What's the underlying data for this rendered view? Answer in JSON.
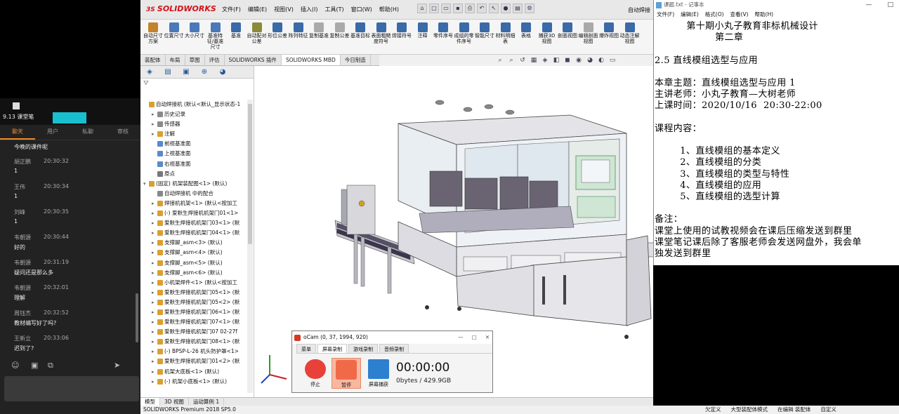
{
  "chat": {
    "window_title": "9.13 课堂笔",
    "tabs": [
      {
        "label": "聊天",
        "active": true
      },
      {
        "label": "用户",
        "active": false
      },
      {
        "label": "私聊",
        "active": false
      },
      {
        "label": "审核",
        "active": false
      }
    ],
    "first_message": "今晚的课件呢",
    "messages": [
      {
        "name": "胡正鹏",
        "time": "20:30:32",
        "text": "1"
      },
      {
        "name": "王伟",
        "time": "20:30:34",
        "text": "1"
      },
      {
        "name": "刘峰",
        "time": "20:30:35",
        "text": "1"
      },
      {
        "name": "韦朝源",
        "time": "20:30:44",
        "text": "好的"
      },
      {
        "name": "韦朝源",
        "time": "20:31:19",
        "text": "疑问还是那么多"
      },
      {
        "name": "韦朝源",
        "time": "20:32:01",
        "text": "理解"
      },
      {
        "name": "周钰杰",
        "time": "20:32:52",
        "text": "教材编写好了吗?"
      },
      {
        "name": "王新立",
        "time": "20:33:06",
        "text": "迟到了?"
      }
    ]
  },
  "solidworks": {
    "logo": "SOLIDWORKS",
    "menu": [
      "文件(F)",
      "编辑(E)",
      "视图(V)",
      "插入(I)",
      "工具(T)",
      "窗口(W)",
      "帮助(H)"
    ],
    "doc_title": "自动焊接",
    "ribbon": [
      {
        "label": "自动尺寸方案",
        "color": "#c2832b"
      },
      {
        "label": "位置尺寸",
        "color": "#4a78b8"
      },
      {
        "label": "大小尺寸",
        "color": "#4a78b8"
      },
      {
        "label": "基准特征/基准尺寸",
        "color": "#4a78b8"
      },
      {
        "label": "基准",
        "color": "#3a6aa8"
      },
      {
        "label": "自动配对公差",
        "color": "#8a8a3a"
      },
      {
        "label": "形位公差",
        "color": "#3a6aa8"
      },
      {
        "label": "阵列特征",
        "color": "#3a6aa8"
      },
      {
        "label": "复制基准",
        "color": "#aaaaaa"
      },
      {
        "label": "复制公差",
        "color": "#aaaaaa"
      },
      {
        "label": "基准目标",
        "color": "#3a6aa8"
      },
      {
        "label": "表面粗糙度符号",
        "color": "#3a6aa8"
      },
      {
        "label": "焊接符号",
        "color": "#3a6aa8"
      },
      {
        "label": "注释",
        "color": "#3a6aa8"
      },
      {
        "label": "零件序号",
        "color": "#3a6aa8"
      },
      {
        "label": "成组的零件序号",
        "color": "#3a6aa8"
      },
      {
        "label": "智能尺寸",
        "color": "#3a6aa8"
      },
      {
        "label": "材料明细表",
        "color": "#3a6aa8"
      },
      {
        "label": "表格",
        "color": "#3a6aa8"
      },
      {
        "label": "捕获3D视图",
        "color": "#3a6aa8"
      },
      {
        "label": "剖面视图",
        "color": "#3a6aa8"
      },
      {
        "label": "编辑剖面视图",
        "color": "#aaaaaa"
      },
      {
        "label": "爆炸视图",
        "color": "#3a6aa8"
      },
      {
        "label": "动态注解视图",
        "color": "#3a6aa8"
      }
    ],
    "command_tabs": [
      {
        "label": "装配体",
        "active": false
      },
      {
        "label": "布局",
        "active": false
      },
      {
        "label": "草图",
        "active": false
      },
      {
        "label": "评估",
        "active": false
      },
      {
        "label": "SOLIDWORKS 插件",
        "active": false
      },
      {
        "label": "SOLIDWORKS MBD",
        "active": true
      },
      {
        "label": "今日制造",
        "active": false
      }
    ],
    "tree": [
      {
        "label": "自动焊接机 (默认<默认_显示状态-1",
        "indent": 0,
        "expander": "",
        "icon": "#d9a030"
      },
      {
        "label": "历史记录",
        "indent": 1,
        "expander": "▸",
        "icon": "#8a8a8a"
      },
      {
        "label": "传感器",
        "indent": 1,
        "expander": "▸",
        "icon": "#8a8a8a"
      },
      {
        "label": "注解",
        "indent": 1,
        "expander": "▸",
        "icon": "#d9a030"
      },
      {
        "label": "前视基准面",
        "indent": 1,
        "expander": "",
        "icon": "#5a8ac8"
      },
      {
        "label": "上视基准面",
        "indent": 1,
        "expander": "",
        "icon": "#5a8ac8"
      },
      {
        "label": "右视基准面",
        "indent": 1,
        "expander": "",
        "icon": "#5a8ac8"
      },
      {
        "label": "原点",
        "indent": 1,
        "expander": "",
        "icon": "#777777"
      },
      {
        "label": "(固定) 机架装配图<1> (默认)",
        "indent": 0,
        "expander": "▾",
        "icon": "#d9a030"
      },
      {
        "label": "自动焊接机 中的配合",
        "indent": 1,
        "expander": "",
        "icon": "#888888"
      },
      {
        "label": "焊接机机架<1> (默认<按加工",
        "indent": 1,
        "expander": "▸",
        "icon": "#d9a030"
      },
      {
        "label": "(-) 爱默生焊接机机架门01<1>",
        "indent": 1,
        "expander": "▸",
        "icon": "#d9a030"
      },
      {
        "label": "爱默生焊接机机架门03<1> (默",
        "indent": 1,
        "expander": "▸",
        "icon": "#d9a030"
      },
      {
        "label": "爱默生焊接机机架门04<1> (默",
        "indent": 1,
        "expander": "▸",
        "icon": "#d9a030"
      },
      {
        "label": "支撑脚_asm<3> (默认)",
        "indent": 1,
        "expander": "▸",
        "icon": "#d9a030"
      },
      {
        "label": "支撑脚_asm<4> (默认)",
        "indent": 1,
        "expander": "▸",
        "icon": "#d9a030"
      },
      {
        "label": "支撑脚_asm<5> (默认)",
        "indent": 1,
        "expander": "▸",
        "icon": "#d9a030"
      },
      {
        "label": "支撑脚_asm<6> (默认)",
        "indent": 1,
        "expander": "▸",
        "icon": "#d9a030"
      },
      {
        "label": "小机架焊件<1> (默认<按加工",
        "indent": 1,
        "expander": "▸",
        "icon": "#d9a030"
      },
      {
        "label": "爱默生焊接机机架门05<1> (默",
        "indent": 1,
        "expander": "▸",
        "icon": "#d9a030"
      },
      {
        "label": "爱默生焊接机机架门05<2> (默",
        "indent": 1,
        "expander": "▸",
        "icon": "#d9a030"
      },
      {
        "label": "爱默生焊接机机架门06<1> (默",
        "indent": 1,
        "expander": "▸",
        "icon": "#d9a030"
      },
      {
        "label": "爱默生焊接机机架门07<1> (默",
        "indent": 1,
        "expander": "▸",
        "icon": "#d9a030"
      },
      {
        "label": "爱默生焊接机机架门07 02-27f",
        "indent": 1,
        "expander": "▸",
        "icon": "#d9a030"
      },
      {
        "label": "爱默生焊接机机架门08<1> (默",
        "indent": 1,
        "expander": "▸",
        "icon": "#d9a030"
      },
      {
        "label": "(-) BPSP-L-26 机头防护罩<1>",
        "indent": 1,
        "expander": "▸",
        "icon": "#d9a030"
      },
      {
        "label": "爱默生焊接机机架门01<2> (默",
        "indent": 1,
        "expander": "▸",
        "icon": "#d9a030"
      },
      {
        "label": "机架大底板<1> (默认)",
        "indent": 1,
        "expander": "▸",
        "icon": "#d9a030"
      },
      {
        "label": "(-) 机架小底板<1> (默认)",
        "indent": 1,
        "expander": "▸",
        "icon": "#d9a030"
      }
    ],
    "bottom_tabs": [
      {
        "label": "模型",
        "active": true
      },
      {
        "label": "3D 视图",
        "active": false
      },
      {
        "label": "运动算例 1",
        "active": false
      }
    ],
    "status_left": "SOLIDWORKS Premium 2018 SP5.0"
  },
  "ocam": {
    "title": "oCam (0, 37, 1994, 920)",
    "tabs": [
      {
        "label": "菜单",
        "active": false
      },
      {
        "label": "屏幕录制",
        "active": true
      },
      {
        "label": "游戏录制",
        "active": false
      },
      {
        "label": "音频录制",
        "active": false
      }
    ],
    "stop_label": "停止",
    "pause_label": "暂停",
    "capture_label": "屏幕捕获",
    "elapsed": "00:00:00",
    "bytes": "0bytes / 429.9GB",
    "colors": {
      "stop": "#e8413a",
      "pause": "#f06a4a",
      "capture": "#2d7fd0"
    }
  },
  "notepad": {
    "title": "课题.txt - 记事本",
    "menu": [
      "文件(F)",
      "编辑(E)",
      "格式(O)",
      "查看(V)",
      "帮助(H)"
    ],
    "content": "          第十期小丸子教育非标机械设计\n                   第二章\n\n2.5 直线模组选型与应用\n\n本章主题：直线模组选型与应用 1\n主讲老师：小丸子教育—大树老师\n上课时间：2020/10/16  20:30-22:00\n\n课程内容：\n\n        1、直线模组的基本定义\n        2、直线模组的分类\n        3、直线模组的类型与特性\n        4、直线模组的应用\n        5、直线模组的选型计算\n\n备注：\n课堂上使用的试教视频会在课后压缩发送到群里\n课堂笔记课后除了客服老师会发送网盘外，我会单\n独发送到群里"
  },
  "taskbar": {
    "items": [
      "欠定义",
      "大型装配体模式",
      "在编辑 装配体",
      "自定义"
    ]
  }
}
